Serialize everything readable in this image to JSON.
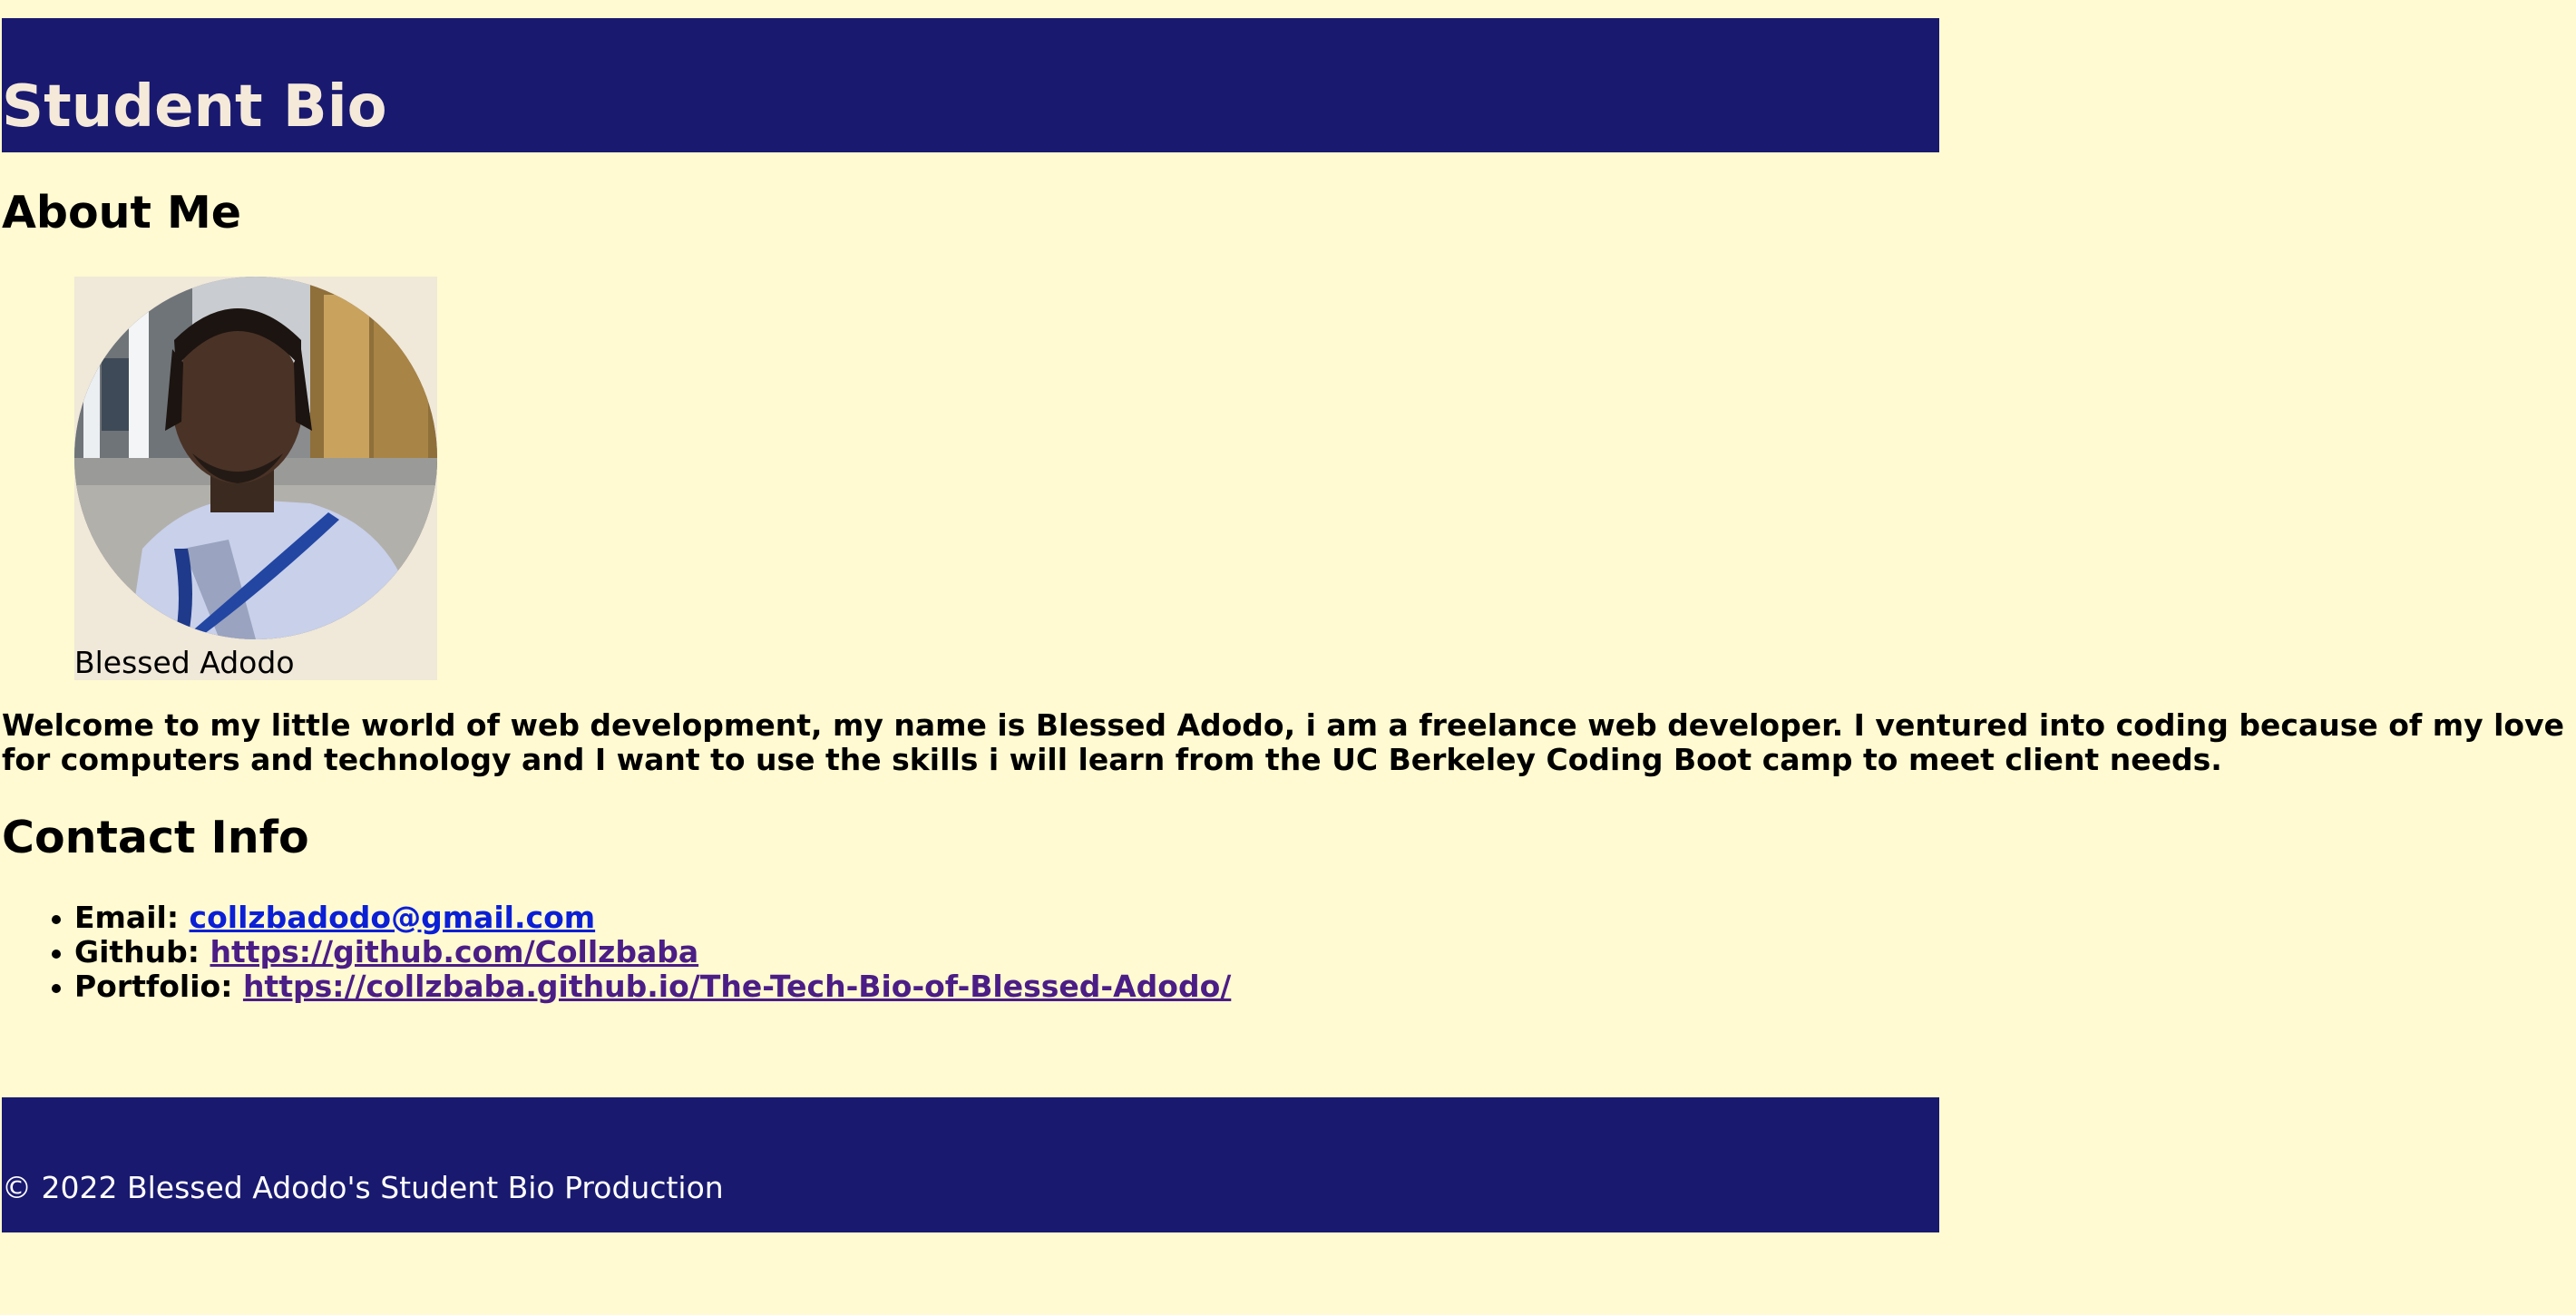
{
  "header": {
    "title": "Student Bio"
  },
  "about": {
    "heading": "About Me",
    "photo_caption": "Blessed Adodo",
    "intro": "Welcome to my little world of web development, my name is Blessed Adodo, i am a freelance web developer. I ventured into coding because of my love for computers and technology and I want to use the skills i will learn from the UC Berkeley Coding Boot camp to meet client needs."
  },
  "contact": {
    "heading": "Contact Info",
    "items": [
      {
        "label": "Email:",
        "link": "collzbadodo@gmail.com"
      },
      {
        "label": "Github:",
        "link": "https://github.com/Collzbaba"
      },
      {
        "label": "Portfolio:",
        "link": "https://collzbaba.github.io/The-Tech-Bio-of-Blessed-Adodo/"
      }
    ]
  },
  "footer": {
    "text": "© 2022 Blessed Adodo's Student Bio Production"
  },
  "colors": {
    "background": "#fffad1",
    "bar": "#191970",
    "title_text": "#f5ead9",
    "link": "#0b1fd6",
    "link_visited": "#4b1d86"
  }
}
